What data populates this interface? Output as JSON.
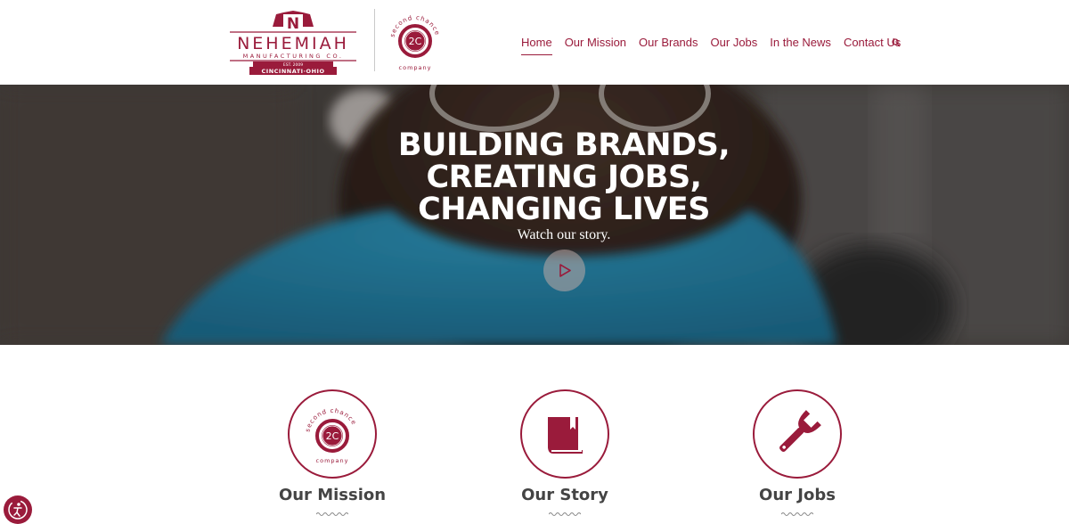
{
  "brand": {
    "name": "NEHEMIAH",
    "subname": "MANUFACTURING CO.",
    "est": "EST. 2009",
    "location": "CINCINNATI·OHIO",
    "logo_letter": "N",
    "second_chance_top": "second chance",
    "second_chance_mark": "2C",
    "second_chance_bottom": "company"
  },
  "nav": {
    "items": [
      {
        "label": "Home",
        "active": true
      },
      {
        "label": "Our Mission",
        "active": false
      },
      {
        "label": "Our Brands",
        "active": false
      },
      {
        "label": "Our Jobs",
        "active": false
      },
      {
        "label": "In the News",
        "active": false
      },
      {
        "label": "Contact Us",
        "active": false
      }
    ],
    "search_icon": "search-icon"
  },
  "hero": {
    "title_lines": [
      "BUILDING BRANDS,",
      "CREATING JOBS,",
      "CHANGING LIVES"
    ],
    "subtitle": "Watch our story.",
    "play_icon": "play-icon"
  },
  "features": [
    {
      "title": "Our Mission",
      "icon": "second-chance-logo-icon",
      "icon_top": "second chance",
      "icon_mark": "2C",
      "icon_bottom": "company"
    },
    {
      "title": "Our Story",
      "icon": "book-icon"
    },
    {
      "title": "Our Jobs",
      "icon": "wrench-icon"
    }
  ],
  "colors": {
    "accent": "#9a1b3b",
    "nav_text": "#9a1b3b",
    "heading_text": "#444444",
    "hero_text": "#ffffff"
  },
  "accessibility_icon": "accessibility-icon"
}
